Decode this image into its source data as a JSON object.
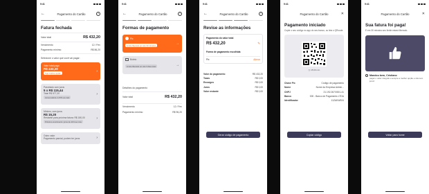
{
  "status": {
    "time": "9:41"
  },
  "screen1": {
    "nav_title": "Pagamento do Cartão",
    "heading": "Fatura fechada",
    "total_label": "Valor total",
    "total_value": "R$ 432,20",
    "due_label": "Vencimento",
    "due_value": "12 / Fev",
    "min_label": "Pagamento mínimo",
    "min_value": "R$ 86,20",
    "question": "Selecione o valor que você vai pagar:",
    "opt1_title": "Valor total pago",
    "opt1_value": "R$ 432,20",
    "opt1_badge": "Sua melhor opção",
    "opt2_title": "Parcelado com juros",
    "opt2_value": "5 x R$ 115,44",
    "opt2_sub": "Total R$ 577,20",
    "opt2_badge": "Juros total de 1,67% ao mês",
    "opt3_title": "Mínimo, com juros",
    "opt3_value": "R$ 15,20",
    "opt3_sub": "Restante para próxima fatura: R$ 180,00",
    "opt3_badge": "Próximo vencimento: juros de 11% ao mês",
    "opt4_title": "Outro valor",
    "opt4_sub": "Pagamento parcial, podem ter juros"
  },
  "screen2": {
    "nav_title": "Pagamento do Cartão",
    "heading": "Formas de pagamento",
    "pix_label": "Pix",
    "pix_badge": "Limite liberado em até 30 minutos",
    "boleto_label": "Boleto",
    "boleto_badge": "Limite liberado em até 3 dias úteis",
    "detail_label": "Detalhes do pagamento",
    "total_label": "Valor total",
    "total_value": "R$ 432,20",
    "due_label": "Vencimento",
    "due_value": "12 / Fev",
    "min_label": "Pagamento mínimo",
    "min_value": "R$ 96,20"
  },
  "screen3": {
    "nav_title": "Pagamento do Cartão",
    "heading": "Revise as informações",
    "amount_label": "Pagamento do valor total",
    "amount_value": "R$ 432,20",
    "method_label": "Forma de pagamento escolhida",
    "method_value": "Pix",
    "method_action": "Alterar",
    "rows": [
      {
        "k": "Valor do pagamento",
        "v": "R$ 432,20"
      },
      {
        "k": "Taxas",
        "v": "R$ 0,00"
      },
      {
        "k": "Encargos",
        "v": "R$ 0,00"
      },
      {
        "k": "Juros",
        "v": "R$ 0,00"
      },
      {
        "k": "Valor restante",
        "v": "R$ 0,00"
      }
    ],
    "button": "Gerar código de pagamento"
  },
  "screen4": {
    "nav_title": "Pagamento do Cartão",
    "heading": "Pagamento iniciado",
    "desc": "Copie o seu código no app do seu banco, ou leia o QRcode.",
    "timer": "15:00 min",
    "rows": [
      {
        "k": "Chave Pix",
        "v": "Código de pagamento"
      },
      {
        "k": "Nome",
        "v": "Nome da Empresa Admin..."
      },
      {
        "k": "CNPJ",
        "v": "21.192.267/0001-41"
      },
      {
        "k": "Banco",
        "v": "000 - Banco de Pagamento LTDA"
      },
      {
        "k": "Identificador",
        "v": "11ZAKW924"
      }
    ],
    "button": "Copiar código"
  },
  "screen5": {
    "nav_title": "Pagamento do Cartão",
    "heading": "Sua fatura foi paga!",
    "desc": "E em 30 minutos seu limite estará liberado.",
    "thanks": "Mandou bem, Cristiano",
    "note": "pagar o valor integral é sempre a melhor opção e não tem juros!",
    "button": "Voltar para home"
  },
  "colors": {
    "accent": "#ff6a1a",
    "primary": "#3c3a59",
    "card": "#e6e6ea"
  }
}
